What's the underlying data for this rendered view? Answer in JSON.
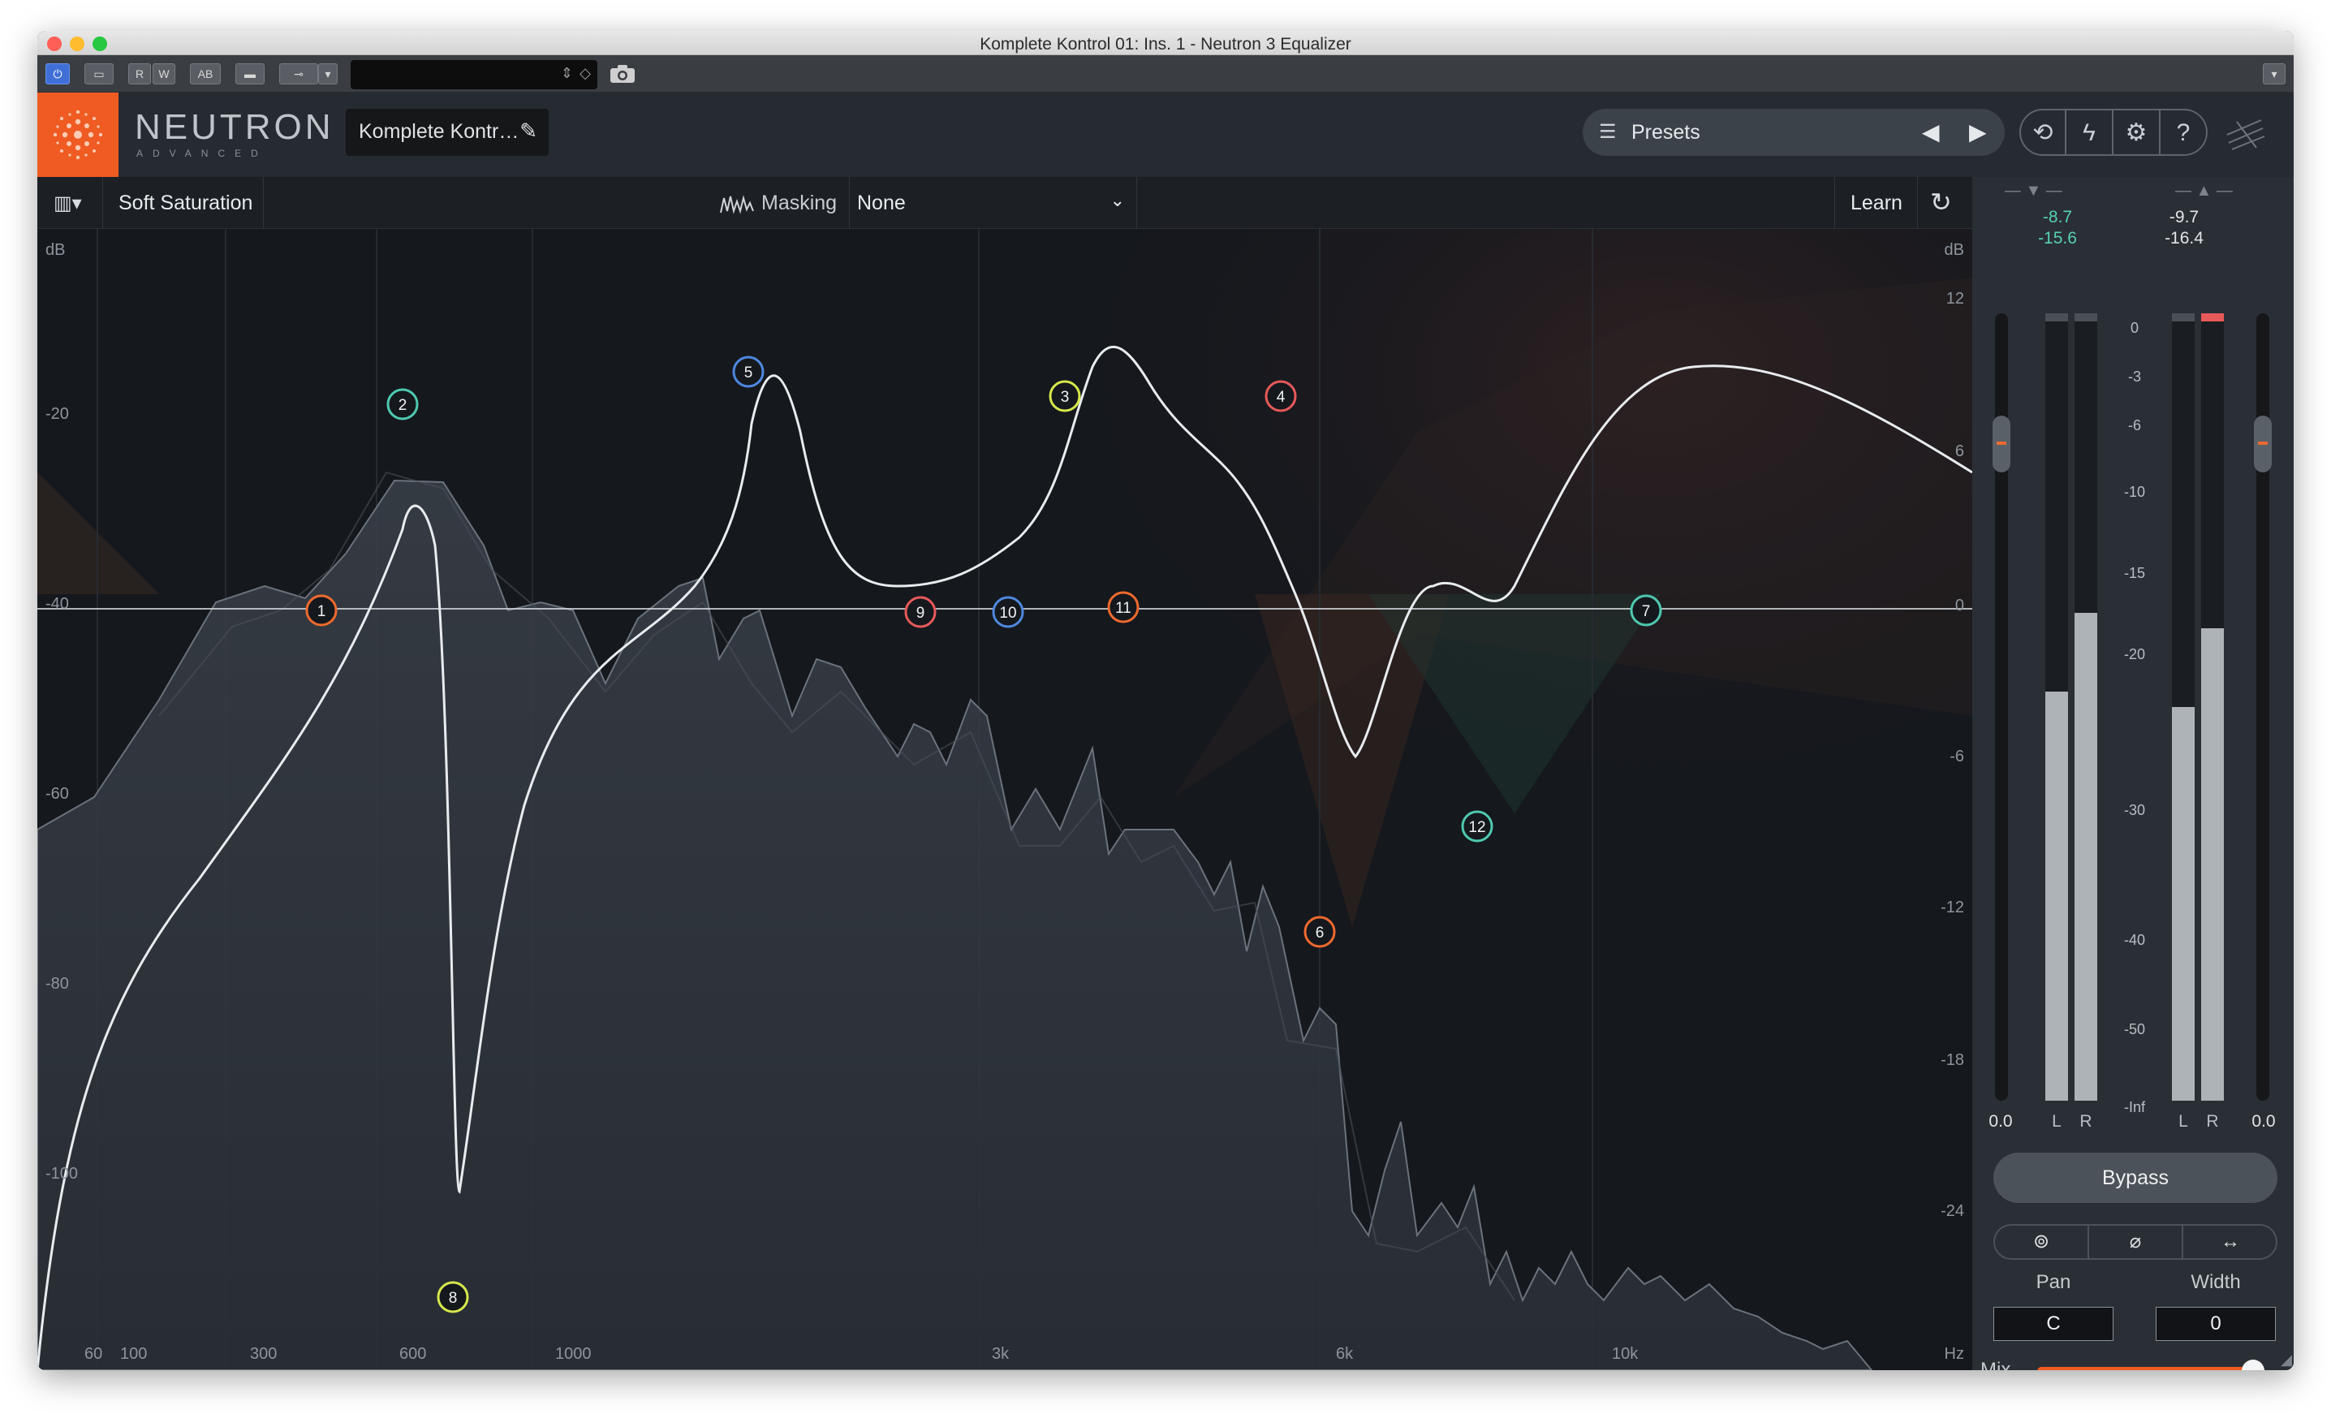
{
  "window": {
    "title": "Komplete Kontrol 01: Ins. 1 - Neutron 3 Equalizer",
    "traffic_lights": {
      "close": "#ff5f57",
      "minimize": "#febc2e",
      "zoom": "#28c840"
    }
  },
  "host_toolbar": {
    "buttons": [
      "⏻",
      "▭",
      "R",
      "W",
      "AB",
      "▬",
      "⊸"
    ]
  },
  "header": {
    "brand": "NEUTRON",
    "brand_sub": "ADVANCED",
    "preset_name": "Komplete Kontr…",
    "presets_label": "Presets",
    "accent": "#ef5b22"
  },
  "toolbar": {
    "module_name": "Soft Saturation",
    "masking_label": "Masking",
    "masking_value": "None",
    "learn_label": "Learn"
  },
  "eq": {
    "left_axis_unit": "dB",
    "right_axis_unit": "dB",
    "left_axis": [
      "-20",
      "-40",
      "-60",
      "-80",
      "-100"
    ],
    "right_axis": [
      "12",
      "6",
      "0",
      "-6",
      "-12",
      "-18",
      "-24"
    ],
    "freq_unit": "Hz",
    "freq_labels": [
      "60",
      "100",
      "300",
      "600",
      "1000",
      "3k",
      "6k",
      "10k"
    ],
    "nodes": [
      {
        "label": "1",
        "color": "#ef6a2e"
      },
      {
        "label": "2",
        "color": "#4ec9b0"
      },
      {
        "label": "3",
        "color": "#d7e84b"
      },
      {
        "label": "4",
        "color": "#e8595a"
      },
      {
        "label": "5",
        "color": "#4f88e0"
      },
      {
        "label": "6",
        "color": "#ef6a2e"
      },
      {
        "label": "7",
        "color": "#4ec9b0"
      },
      {
        "label": "8",
        "color": "#d7e84b"
      },
      {
        "label": "9",
        "color": "#e8595a"
      },
      {
        "label": "10",
        "color": "#4f88e0"
      },
      {
        "label": "11",
        "color": "#ef6a2e"
      },
      {
        "label": "12",
        "color": "#4ec9b0"
      }
    ]
  },
  "meters": {
    "input": {
      "peak": "-8.7",
      "rms": "-15.6",
      "gain": "0.0"
    },
    "output": {
      "peak": "-9.7",
      "rms": "-16.4",
      "gain": "0.0"
    },
    "scale": [
      "0",
      "-3",
      "-6",
      "-10",
      "-15",
      "-20",
      "-30",
      "-40",
      "-50",
      "-Inf"
    ],
    "channel_l": "L",
    "channel_r": "R",
    "levels": {
      "in_l": 0.52,
      "in_r": 0.62,
      "out_l": 0.5,
      "out_r": 0.6
    },
    "bypass_label": "Bypass",
    "pan_label": "Pan",
    "pan_value": "C",
    "width_label": "Width",
    "width_value": "0",
    "mix_label": "Mix",
    "mix_level": 1.0
  }
}
